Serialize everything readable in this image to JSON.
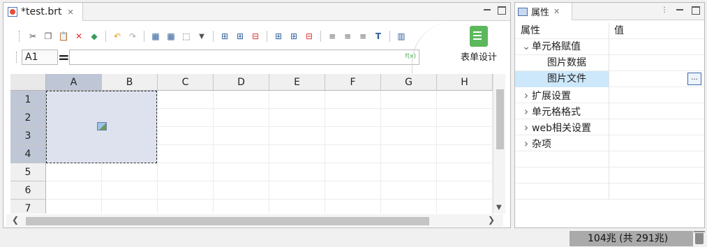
{
  "editor": {
    "tab_title": "*test.brt",
    "toolbar_icons": [
      "cut-icon",
      "copy-icon",
      "paste-icon",
      "delete-icon",
      "eraser-icon",
      "undo-icon",
      "redo-icon",
      "merge-cells-icon",
      "grid-icon",
      "border-icon",
      "dropdown-arrow-icon",
      "insert-row-above-icon",
      "insert-row-below-icon",
      "delete-row-icon",
      "insert-col-left-icon",
      "insert-col-right-icon",
      "delete-col-icon",
      "align-left-icon",
      "align-center-icon",
      "align-right-icon",
      "text-format-icon",
      "chart-icon"
    ],
    "cell_ref": "A1",
    "equals": "=",
    "fx_label": "f(x)",
    "formula_value": "",
    "form_design_label": "表单设计",
    "columns": [
      "A",
      "B",
      "C",
      "D",
      "E",
      "F",
      "G",
      "H"
    ],
    "rows": [
      "1",
      "2",
      "3",
      "4",
      "5",
      "6",
      "7"
    ],
    "selected_column": "A",
    "selected_rows": [
      "1",
      "2",
      "3",
      "4"
    ]
  },
  "properties": {
    "tab_title": "属性",
    "header": {
      "name": "属性",
      "value": "值"
    },
    "rows": [
      {
        "label": "单元格赋值",
        "expanded": true,
        "level": 0
      },
      {
        "label": "图片数据",
        "level": 1
      },
      {
        "label": "图片文件",
        "level": 1,
        "selected": true,
        "button": "..."
      },
      {
        "label": "扩展设置",
        "expanded": false,
        "level": 0
      },
      {
        "label": "单元格格式",
        "expanded": false,
        "level": 0
      },
      {
        "label": "web相关设置",
        "expanded": false,
        "level": 0
      },
      {
        "label": "杂项",
        "expanded": false,
        "level": 0
      }
    ]
  },
  "status": {
    "memory": "104兆 (共 291兆)"
  },
  "colors": {
    "selection": "#bfc7d6",
    "merged_cell": "#dde2ee",
    "row_selected": "#cde8fb",
    "accent_green": "#5cb85c"
  }
}
